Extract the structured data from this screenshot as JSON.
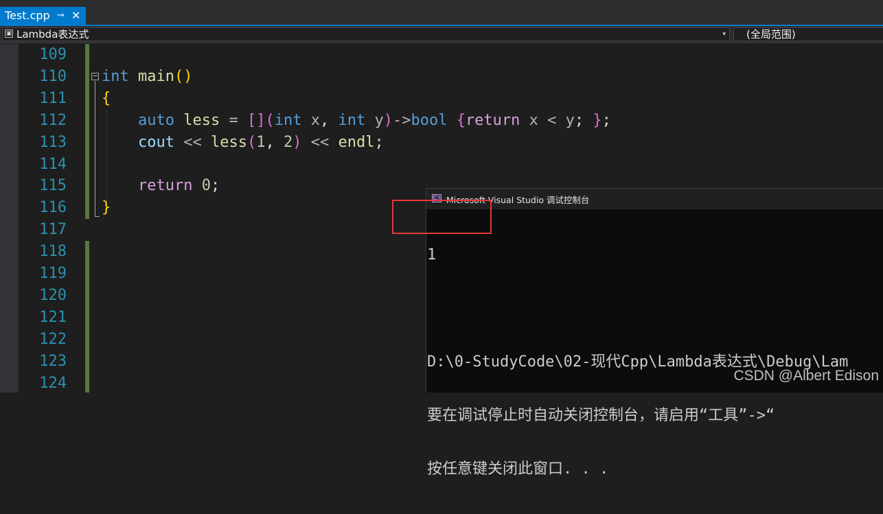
{
  "tab": {
    "title": "Test.cpp",
    "pin_icon": "⊸",
    "close_icon": "✕"
  },
  "navbar": {
    "scope": "Lambda表达式",
    "scope_icon": "▣",
    "global": "(全局范围)",
    "dropdown_icon": "▾"
  },
  "editor": {
    "line_numbers": [
      "109",
      "110",
      "111",
      "112",
      "113",
      "114",
      "115",
      "116",
      "117",
      "118",
      "119",
      "120",
      "121",
      "122",
      "123",
      "124"
    ],
    "colors": {
      "line_number": "#2b91af",
      "keyword": "#569cd6",
      "function": "#dcdcaa",
      "variable": "#9cdcfe",
      "number": "#b5cea8",
      "control": "#d8a0df",
      "change_bar": "#57773c"
    },
    "tokens": {
      "t_int": "int",
      "t_main": "main",
      "t_lpar": "(",
      "t_rpar": ")",
      "t_lbrace": "{",
      "t_auto": "auto",
      "t_less": "less",
      "t_eq": "=",
      "t_lbr": "[]",
      "t_lp2": "(",
      "t_int2": "int",
      "t_x": "x",
      "t_comma": ",",
      "t_int3": "int",
      "t_y": "y",
      "t_rp2": ")",
      "t_arrow": "->",
      "t_bool": "bool",
      "t_lb2": "{",
      "t_return": "return",
      "t_x2": "x",
      "t_lt": "<",
      "t_y2": "y",
      "t_semi": ";",
      "t_rb2": "}",
      "t_semi2": ";",
      "t_cout": "cout",
      "t_shl": "<<",
      "t_less2": "less",
      "t_lp3": "(",
      "t_one": "1",
      "t_comma2": ",",
      "t_two": "2",
      "t_rp3": ")",
      "t_shl2": "<<",
      "t_endl": "endl",
      "t_semi3": ";",
      "t_return2": "return",
      "t_zero": "0",
      "t_semi4": ";",
      "t_rbrace": "}"
    }
  },
  "console": {
    "title": "Microsoft Visual Studio 调试控制台",
    "icon": "C:\\",
    "lines": [
      "1",
      "",
      "D:\\0-StudyCode\\02-现代Cpp\\Lambda表达式\\Debug\\Lam",
      "要在调试停止时自动关闭控制台，请启用“工具”->“",
      "按任意键关闭此窗口. . ."
    ]
  },
  "watermark": "CSDN @Albert Edison"
}
